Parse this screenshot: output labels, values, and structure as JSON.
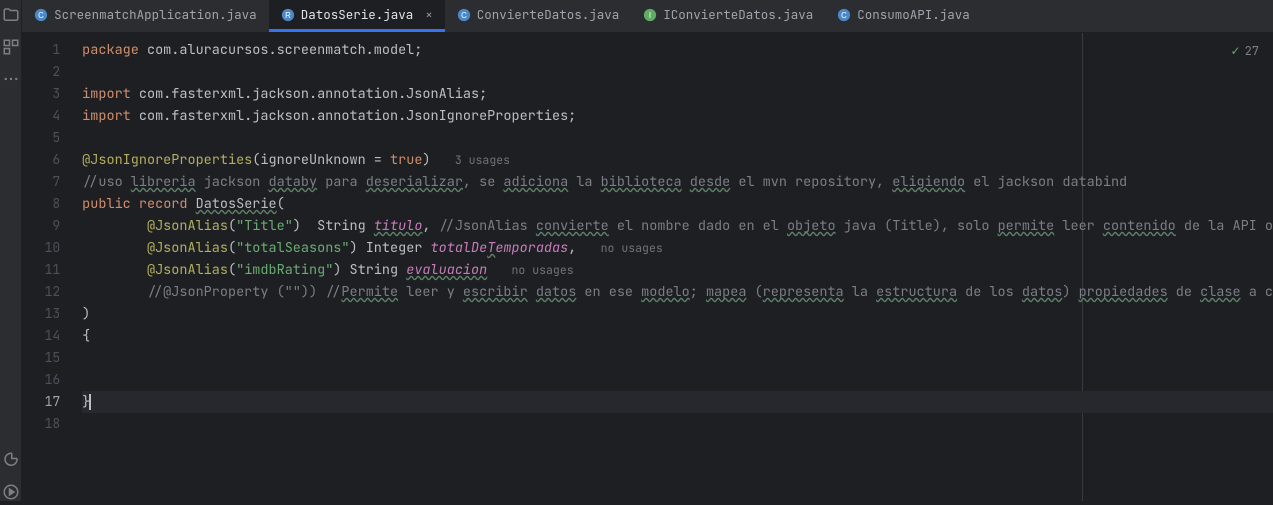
{
  "tabs": [
    {
      "label": "ScreenmatchApplication.java",
      "icon": "class",
      "iconColor": "#4a88c7"
    },
    {
      "label": "DatosSerie.java",
      "icon": "record",
      "iconColor": "#4a88c7",
      "active": true,
      "closable": true
    },
    {
      "label": "ConvierteDatos.java",
      "icon": "class",
      "iconColor": "#4a88c7"
    },
    {
      "label": "IConvierteDatos.java",
      "icon": "interface",
      "iconColor": "#5fad65"
    },
    {
      "label": "ConsumoAPI.java",
      "icon": "class",
      "iconColor": "#4a88c7"
    }
  ],
  "inspection": {
    "count": "27"
  },
  "currentLine": 17,
  "code": {
    "l1": {
      "kw": "package",
      "rest": " com.aluracursos.screenmatch.model;"
    },
    "l3": {
      "kw": "import",
      "rest": " com.fasterxml.jackson.annotation.JsonAlias;"
    },
    "l4": {
      "kw": "import",
      "rest": " com.fasterxml.jackson.annotation.JsonIgnoreProperties;"
    },
    "l6": {
      "ann": "@JsonIgnoreProperties",
      "args_open": "(",
      "arg_name": "ignoreUnknown",
      "eq": " = ",
      "arg_val": "true",
      "args_close": ")",
      "hint": "3 usages"
    },
    "l7": {
      "cmt_pre": "//uso ",
      "w1": "libreria",
      "mid1": " jackson ",
      "w2": "databy",
      "mid2": " para ",
      "w3": "deserializar",
      "mid3": ", se ",
      "w4": "adiciona",
      "mid4": " la ",
      "w5": "biblioteca",
      "mid5": " ",
      "w6": "desde",
      "mid6": " el mvn repository, ",
      "w7": "eligiendo",
      "mid7": " el jackson databind"
    },
    "l8": {
      "kw1": "public",
      "kw2": "record",
      "name": "DatosSerie",
      "open": "("
    },
    "l9": {
      "indent": "        ",
      "ann": "@JsonAlias",
      "open": "(",
      "str": "\"Title\"",
      "close": ")  ",
      "type": "String",
      "sp": " ",
      "field": "titulo",
      "comma": ", ",
      "cmt_pre": "//JsonAlias ",
      "w1": "convierte",
      "m1": " el nombre dado en el ",
      "w2": "objeto",
      "m2": " java (Title), solo ",
      "w3": "permite",
      "m3": " leer ",
      "w4": "contenido",
      "m4": " de la API o"
    },
    "l10": {
      "indent": "        ",
      "ann": "@JsonAlias",
      "open": "(",
      "str": "\"totalSeasons\"",
      "close": ") ",
      "type": "Integer",
      "sp": " ",
      "field_pre": "totalDe",
      "field_w": "T",
      "field_post": "emporadas",
      "comma": ",",
      "hint": "no usages"
    },
    "l11": {
      "indent": "        ",
      "ann": "@JsonAlias",
      "open": "(",
      "str": "\"imdbRating\"",
      "close": ") ",
      "type": "String",
      "sp": " ",
      "field": "evaluacion",
      "hint": "no usages"
    },
    "l12": {
      "indent": "        ",
      "cmt1": "//@JsonProperty (\"\")) //",
      "w1": "Permite",
      "m1": " leer y ",
      "w2": "escribir",
      "m2": " ",
      "w3": "datos",
      "m3": " en ese ",
      "w4": "modelo",
      "m4": "; ",
      "w5": "mapea",
      "m5": " (",
      "w6": "representa",
      "m6": " la ",
      "w7": "estructura",
      "m7": " de los ",
      "w8": "datos",
      "m8": ") ",
      "w9": "propiedades",
      "m9": " de ",
      "w10": "clase",
      "m10": " a c"
    },
    "l13": {
      "text": ")"
    },
    "l14": {
      "text": "{"
    },
    "l17": {
      "text": "}"
    }
  }
}
